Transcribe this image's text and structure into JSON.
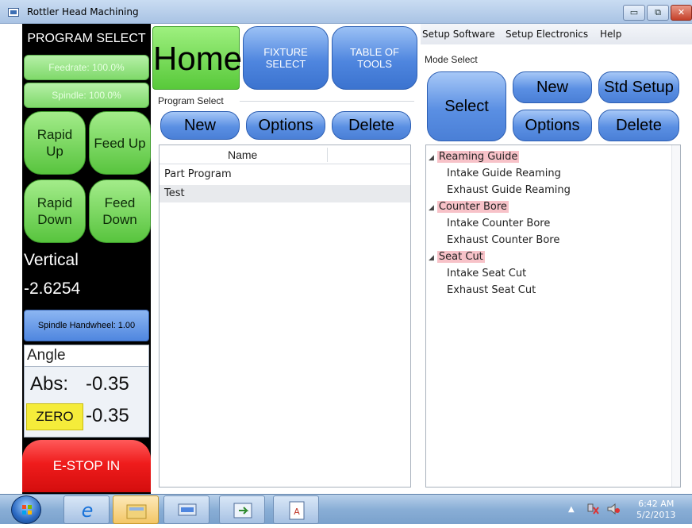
{
  "window": {
    "title": "Rottler Head Machining"
  },
  "left": {
    "program_select": "PROGRAM SELECT",
    "feedrate": "Feedrate: 100.0%",
    "spindle": "Spindle: 100.0%",
    "rapid_up": "Rapid Up",
    "feed_up": "Feed Up",
    "rapid_down": "Rapid Down",
    "feed_down": "Feed Down",
    "vertical_label": "Vertical",
    "vertical_value": "-2.6254",
    "handwheel": "Spindle Handwheel: 1.00",
    "angle_title": "Angle",
    "abs_label": "Abs:",
    "abs_value": "-0.35",
    "zero_label": "ZERO",
    "zero_value": "-0.35",
    "estop": "E-STOP IN"
  },
  "nav": {
    "home": "Home",
    "fixture_select": "FIXTURE SELECT",
    "table_of_tools": "TABLE OF TOOLS"
  },
  "program": {
    "group_label": "Program Select",
    "new": "New",
    "options": "Options",
    "delete": "Delete",
    "column_name": "Name",
    "rows": [
      "Part Program",
      "Test"
    ]
  },
  "menu": {
    "setup_software": "Setup Software",
    "setup_electronics": "Setup Electronics",
    "help": "Help"
  },
  "mode": {
    "label": "Mode Select",
    "select": "Select",
    "new": "New",
    "std_setup": "Std Setup",
    "options": "Options",
    "delete": "Delete"
  },
  "tree": {
    "groups": [
      {
        "label": "Reaming Guide",
        "children": [
          "Intake Guide Reaming",
          "Exhaust Guide Reaming"
        ]
      },
      {
        "label": "Counter Bore",
        "children": [
          "Intake Counter Bore",
          "Exhaust Counter Bore"
        ]
      },
      {
        "label": "Seat Cut",
        "children": [
          "Intake Seat Cut",
          "Exhaust Seat Cut"
        ]
      }
    ]
  },
  "taskbar": {
    "time": "6:42 AM",
    "date": "5/2/2013"
  }
}
